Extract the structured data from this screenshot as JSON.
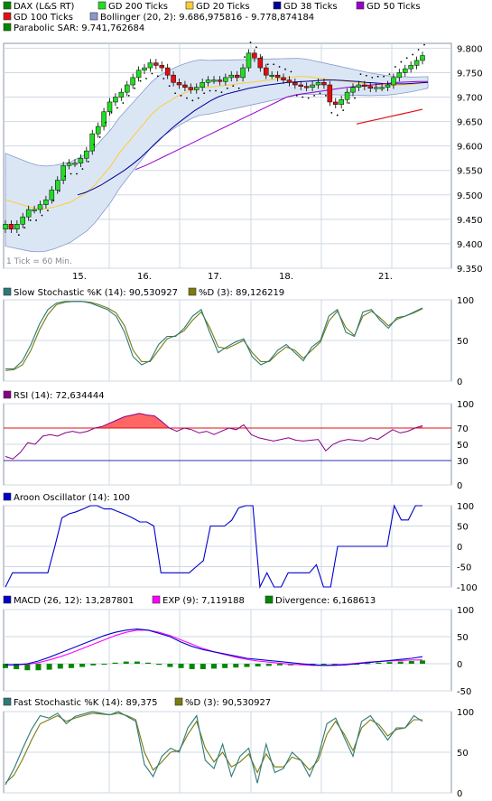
{
  "colors": {
    "grid": "#cfd8e3",
    "border": "#8a96a8",
    "axis_text": "#000000",
    "candle_up": "#22dd22",
    "candle_down": "#e01010",
    "gd200": "#00cc00",
    "gd20": "#ffcc33",
    "gd38": "#000099",
    "gd50": "#9900cc",
    "gd100": "#e01010",
    "bollinger_fill": "#dbe6f5",
    "bollinger_line": "#8899cc",
    "sar": "#000000",
    "slow_k": "#2a7a78",
    "slow_d": "#7a7a10",
    "rsi_line": "#880088",
    "rsi_fill": "#ff6666",
    "rsi_70": "#e01010",
    "rsi_30": "#3333aa",
    "aroon": "#0000cc",
    "macd": "#0000cc",
    "exp": "#ff00ff",
    "divergence": "#008800",
    "fast_k": "#2a7a78",
    "fast_d": "#7a7a10"
  },
  "price_panel": {
    "legend": [
      {
        "label": "DAX (L&S RT)",
        "color": "#008800"
      },
      {
        "label": "GD 200 Ticks",
        "color": "#22dd22"
      },
      {
        "label": "GD 20 Ticks",
        "color": "#ffcc33"
      },
      {
        "label": "GD 38 Ticks",
        "color": "#000099"
      },
      {
        "label": "GD 50 Ticks",
        "color": "#9900cc"
      },
      {
        "label": "GD 100 Ticks",
        "color": "#e01010"
      },
      {
        "label": "Bollinger (20, 2): 9.686,975816 - 9.778,874184",
        "color": "#8899cc"
      },
      {
        "label": "Parabolic SAR: 9.741,762684",
        "color": "#008800"
      }
    ],
    "tick_note": "1 Tick = 60 Min.",
    "y_ticks": [
      "9.800",
      "9.750",
      "9.700",
      "9.650",
      "9.600",
      "9.550",
      "9.500",
      "9.450",
      "9.400",
      "9.350"
    ],
    "x_ticks": [
      "15.",
      "16.",
      "17.",
      "18.",
      "21."
    ]
  },
  "stoch_slow_panel": {
    "legend": [
      {
        "label": "Slow Stochastic %K (14): 90,530927",
        "color": "#2a7a78"
      },
      {
        "label": "%D (3): 89,126219",
        "color": "#7a7a10"
      }
    ],
    "y_ticks": [
      "100",
      "50",
      "0"
    ]
  },
  "rsi_panel": {
    "legend": [
      {
        "label": "RSI (14): 72,634444",
        "color": "#880088"
      }
    ],
    "y_ticks": [
      "100",
      "70",
      "50",
      "30",
      "0"
    ]
  },
  "aroon_panel": {
    "legend": [
      {
        "label": "Aroon Oscillator (14): 100",
        "color": "#0000cc"
      }
    ],
    "y_ticks": [
      "100",
      "50",
      "0",
      "-50",
      "-100"
    ]
  },
  "macd_panel": {
    "legend": [
      {
        "label": "MACD (26, 12): 13,287801",
        "color": "#0000cc"
      },
      {
        "label": "EXP (9): 7,119188",
        "color": "#ff00ff"
      },
      {
        "label": "Divergence: 6,168613",
        "color": "#008800"
      }
    ],
    "y_ticks": [
      "100",
      "50",
      "0",
      "-50"
    ]
  },
  "stoch_fast_panel": {
    "legend": [
      {
        "label": "Fast Stochastic %K (14): 89,375",
        "color": "#2a7a78"
      },
      {
        "label": "%D (3): 90,530927",
        "color": "#7a7a10"
      }
    ],
    "y_ticks": [
      "100",
      "50",
      "0"
    ]
  },
  "chart_data": [
    {
      "type": "candlestick",
      "x_labels": [
        "15.",
        "16.",
        "17.",
        "18.",
        "21."
      ],
      "ylim": [
        9350,
        9810
      ],
      "close": [
        9440,
        9430,
        9440,
        9455,
        9470,
        9470,
        9480,
        9490,
        9510,
        9530,
        9560,
        9565,
        9565,
        9575,
        9590,
        9625,
        9640,
        9670,
        9690,
        9700,
        9710,
        9725,
        9740,
        9755,
        9760,
        9770,
        9765,
        9760,
        9745,
        9730,
        9725,
        9720,
        9715,
        9720,
        9730,
        9735,
        9735,
        9732,
        9740,
        9745,
        9740,
        9760,
        9790,
        9780,
        9760,
        9745,
        9745,
        9740,
        9735,
        9730,
        9725,
        9722,
        9720,
        9725,
        9730,
        9725,
        9690,
        9685,
        9695,
        9710,
        9720,
        9725,
        9722,
        9718,
        9720,
        9720,
        9725,
        9740,
        9750,
        9758,
        9765,
        9775,
        9785
      ],
      "gd20": [
        9490,
        9485,
        9480,
        9475,
        9472,
        9472,
        9475,
        9480,
        9485,
        9495,
        9505,
        9520,
        9540,
        9560,
        9585,
        9605,
        9625,
        9645,
        9665,
        9680,
        9690,
        9700,
        9708,
        9715,
        9720,
        9720,
        9722,
        9724,
        9726,
        9728,
        9730,
        9732,
        9734,
        9736,
        9738,
        9740,
        9742,
        9742,
        9740,
        9738,
        9736,
        9734,
        9732,
        9730,
        9728,
        9726,
        9725,
        9724,
        9724,
        9725,
        9726,
        9728,
        9730
      ],
      "gd38": [
        9500,
        9505,
        9512,
        9520,
        9530,
        9540,
        9550,
        9562,
        9575,
        9590,
        9605,
        9620,
        9635,
        9648,
        9660,
        9672,
        9682,
        9692,
        9700,
        9706,
        9710,
        9714,
        9718,
        9721,
        9724,
        9726,
        9728,
        9730,
        9731,
        9732,
        9733,
        9734,
        9735,
        9735,
        9734,
        9733,
        9732,
        9730,
        9729,
        9728,
        9727,
        9727,
        9727,
        9728,
        9729,
        9730
      ],
      "gd50": [
        9552,
        9560,
        9570,
        9580,
        9590,
        9600,
        9610,
        9620,
        9630,
        9640,
        9650,
        9660,
        9670,
        9680,
        9690,
        9700,
        9705,
        9708,
        9711,
        9714,
        9717,
        9720,
        9722,
        9724,
        9726,
        9728,
        9730,
        9731,
        9732,
        9732
      ],
      "gd100": [
        9645,
        9650,
        9655,
        9660,
        9665,
        9670,
        9675
      ]
    },
    {
      "type": "line",
      "title": "Slow Stochastic",
      "ylim": [
        0,
        100
      ],
      "series": [
        {
          "name": "%K (14)",
          "values": [
            15,
            15,
            25,
            45,
            70,
            88,
            96,
            98,
            98,
            98,
            96,
            92,
            88,
            80,
            60,
            30,
            20,
            25,
            45,
            55,
            55,
            65,
            80,
            88,
            60,
            35,
            42,
            48,
            52,
            30,
            20,
            25,
            38,
            45,
            35,
            25,
            42,
            50,
            80,
            88,
            60,
            55,
            85,
            88,
            75,
            65,
            78,
            80,
            85,
            90
          ]
        },
        {
          "name": "%D (3)",
          "values": [
            13,
            14,
            20,
            38,
            63,
            82,
            94,
            97,
            98,
            98,
            97,
            94,
            90,
            84,
            68,
            38,
            24,
            24,
            38,
            52,
            56,
            62,
            75,
            85,
            66,
            42,
            40,
            45,
            50,
            35,
            24,
            24,
            34,
            42,
            38,
            28,
            38,
            48,
            74,
            86,
            66,
            56,
            80,
            86,
            78,
            68,
            76,
            80,
            84,
            89
          ]
        }
      ]
    },
    {
      "type": "area",
      "title": "RSI (14)",
      "ylim": [
        0,
        100
      ],
      "series": [
        {
          "name": "RSI (14)",
          "values": [
            35,
            32,
            40,
            52,
            50,
            60,
            62,
            60,
            64,
            66,
            64,
            66,
            70,
            72,
            76,
            80,
            84,
            86,
            88,
            86,
            85,
            78,
            70,
            66,
            70,
            68,
            64,
            66,
            62,
            66,
            70,
            68,
            74,
            62,
            58,
            56,
            54,
            56,
            58,
            55,
            54,
            55,
            56,
            42,
            50,
            54,
            56,
            55,
            54,
            58,
            56,
            62,
            68,
            64,
            66,
            70,
            73
          ]
        }
      ]
    },
    {
      "type": "line",
      "title": "Aroon Oscillator (14)",
      "ylim": [
        -100,
        100
      ],
      "series": [
        {
          "name": "Aroon Oscillator (14)",
          "values": [
            -100,
            -65,
            -65,
            -65,
            -65,
            -65,
            -65,
            0,
            70,
            80,
            85,
            92,
            100,
            100,
            92,
            92,
            85,
            78,
            70,
            60,
            60,
            50,
            -65,
            -65,
            -65,
            -65,
            -65,
            -50,
            -35,
            50,
            50,
            50,
            64,
            95,
            100,
            100,
            -100,
            -65,
            -100,
            -100,
            -65,
            -65,
            -65,
            -65,
            -45,
            -100,
            -100,
            0,
            0,
            0,
            0,
            0,
            0,
            0,
            0,
            100,
            65,
            65,
            100,
            100
          ]
        }
      ]
    },
    {
      "type": "line",
      "title": "MACD (26, 12)",
      "ylim": [
        -50,
        100
      ],
      "series": [
        {
          "name": "MACD (26, 12)",
          "values": [
            -2,
            -2,
            0,
            5,
            12,
            20,
            28,
            36,
            44,
            52,
            58,
            62,
            64,
            62,
            56,
            50,
            40,
            32,
            26,
            22,
            18,
            14,
            10,
            8,
            6,
            4,
            2,
            0,
            -2,
            -3,
            -3,
            -2,
            0,
            2,
            4,
            6,
            8,
            10,
            13
          ]
        },
        {
          "name": "EXP (9)",
          "values": [
            -2,
            -2,
            -1,
            2,
            7,
            13,
            20,
            28,
            36,
            44,
            52,
            58,
            62,
            62,
            58,
            52,
            44,
            36,
            28,
            22,
            17,
            12,
            8,
            5,
            3,
            1,
            -1,
            -2,
            -3,
            -3,
            -2,
            -1,
            1,
            3,
            4,
            5,
            6,
            7,
            7
          ]
        },
        {
          "name": "Divergence",
          "values": [
            -8,
            -10,
            -12,
            -12,
            -11,
            -9,
            -8,
            -6,
            -3,
            0,
            2,
            4,
            4,
            2,
            -2,
            -6,
            -8,
            -10,
            -10,
            -9,
            -8,
            -7,
            -6,
            -5,
            -4,
            -3,
            -3,
            -2,
            -1,
            -1,
            0,
            0,
            0,
            1,
            2,
            3,
            4,
            5,
            6
          ]
        }
      ]
    },
    {
      "type": "line",
      "title": "Fast Stochastic",
      "ylim": [
        0,
        100
      ],
      "series": [
        {
          "name": "%K (14)",
          "values": [
            10,
            30,
            55,
            78,
            95,
            92,
            98,
            85,
            94,
            97,
            100,
            98,
            96,
            100,
            94,
            88,
            35,
            20,
            45,
            55,
            50,
            80,
            95,
            40,
            30,
            60,
            20,
            45,
            55,
            12,
            60,
            25,
            30,
            50,
            40,
            20,
            45,
            85,
            92,
            68,
            45,
            88,
            95,
            80,
            65,
            80,
            80,
            95,
            88
          ]
        },
        {
          "name": "%D (3)",
          "values": [
            12,
            22,
            42,
            65,
            85,
            90,
            95,
            88,
            92,
            95,
            98,
            97,
            96,
            98,
            95,
            90,
            50,
            28,
            38,
            50,
            52,
            72,
            88,
            55,
            38,
            50,
            32,
            38,
            48,
            25,
            48,
            32,
            32,
            44,
            40,
            28,
            40,
            72,
            88,
            72,
            52,
            80,
            90,
            84,
            70,
            78,
            80,
            90,
            90
          ]
        }
      ]
    }
  ]
}
